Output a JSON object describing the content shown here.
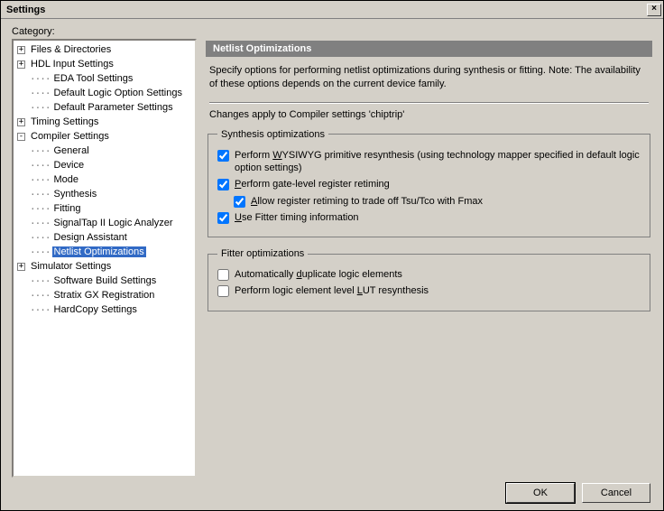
{
  "window": {
    "title": "Settings",
    "close_label": "×"
  },
  "category_label": "Category:",
  "tree": {
    "items": [
      {
        "label": "Files & Directories",
        "depth": 0,
        "exp": "+"
      },
      {
        "label": "HDL Input Settings",
        "depth": 0,
        "exp": "+"
      },
      {
        "label": "EDA Tool Settings",
        "depth": 1,
        "exp": null
      },
      {
        "label": "Default Logic Option Settings",
        "depth": 1,
        "exp": null
      },
      {
        "label": "Default Parameter Settings",
        "depth": 1,
        "exp": null
      },
      {
        "label": "Timing Settings",
        "depth": 0,
        "exp": "+"
      },
      {
        "label": "Compiler Settings",
        "depth": 0,
        "exp": "-"
      },
      {
        "label": "General",
        "depth": 1,
        "exp": null
      },
      {
        "label": "Device",
        "depth": 1,
        "exp": null
      },
      {
        "label": "Mode",
        "depth": 1,
        "exp": null
      },
      {
        "label": "Synthesis",
        "depth": 1,
        "exp": null
      },
      {
        "label": "Fitting",
        "depth": 1,
        "exp": null
      },
      {
        "label": "SignalTap II Logic Analyzer",
        "depth": 1,
        "exp": null
      },
      {
        "label": "Design Assistant",
        "depth": 1,
        "exp": null
      },
      {
        "label": "Netlist Optimizations",
        "depth": 1,
        "exp": null,
        "selected": true
      },
      {
        "label": "Simulator Settings",
        "depth": 0,
        "exp": "+"
      },
      {
        "label": "Software Build Settings",
        "depth": 1,
        "exp": null
      },
      {
        "label": "Stratix GX Registration",
        "depth": 1,
        "exp": null
      },
      {
        "label": "HardCopy Settings",
        "depth": 1,
        "exp": null
      }
    ]
  },
  "panel": {
    "header": "Netlist Optimizations",
    "desc": "Specify options for performing netlist optimizations during synthesis or fitting. Note: The availability of these options depends on the current device family.",
    "subdesc": "Changes apply to Compiler settings 'chiptrip'",
    "synthesis_legend": "Synthesis optimizations",
    "fitter_legend": "Fitter optimizations",
    "chk_wysiwyg": "Perform WYSIWYG primitive resynthesis (using technology mapper specified in default logic option settings)",
    "chk_gate": "Perform gate-level register retiming",
    "chk_allow": "Allow register retiming to trade off Tsu/Tco with Fmax",
    "chk_usefitter": "Use Fitter timing information",
    "chk_auto_dup": "Automatically duplicate logic elements",
    "chk_lut": "Perform logic element level LUT resynthesis"
  },
  "buttons": {
    "ok": "OK",
    "cancel": "Cancel"
  },
  "checked": {
    "wysiwyg": true,
    "gate": true,
    "allow": true,
    "usefitter": true,
    "auto_dup": false,
    "lut": false
  }
}
